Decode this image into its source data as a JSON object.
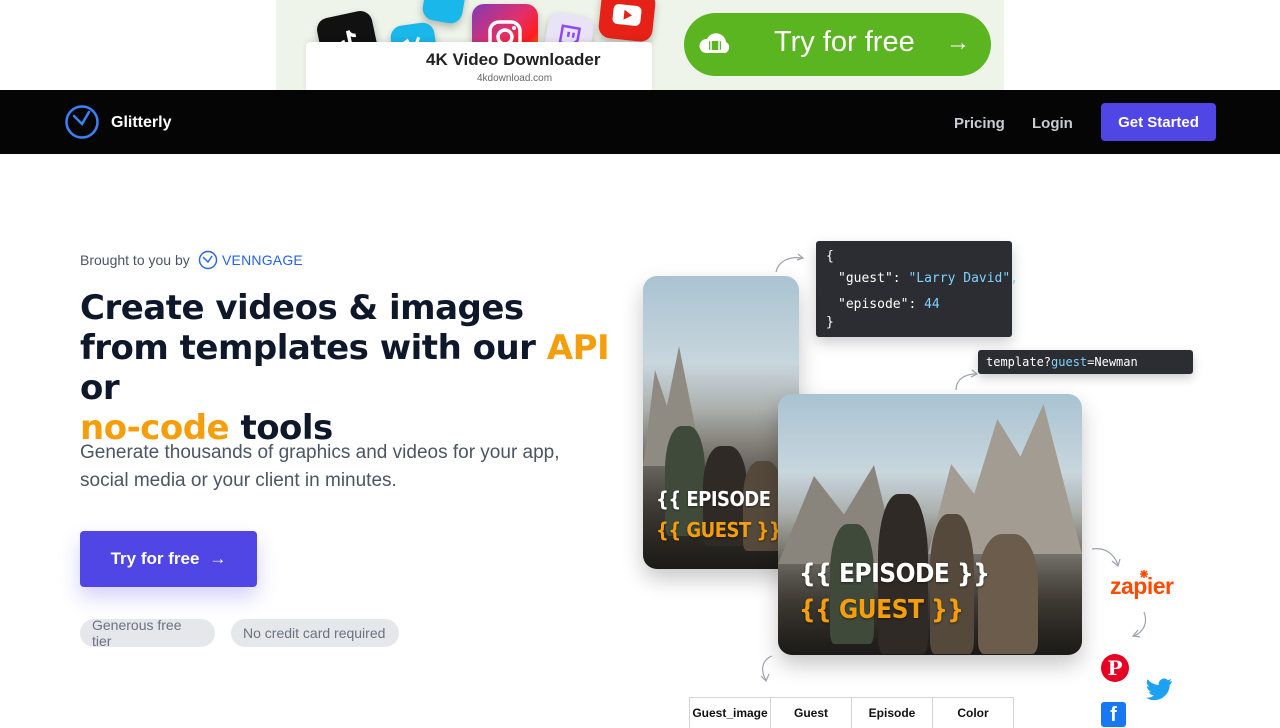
{
  "ad": {
    "title": "4K Video Downloader",
    "domain": "4kdownload.com",
    "cta_label": "Try for free",
    "cta_arrow": "→",
    "colors": {
      "cta": "#5bb521",
      "background": "#eef4ea"
    },
    "icons": [
      "tiktok-icon",
      "vimeo-icon",
      "instagram-icon",
      "twitch-icon",
      "youtube-icon"
    ]
  },
  "nav": {
    "brand": "Glitterly",
    "links": {
      "pricing": "Pricing",
      "login": "Login"
    },
    "cta": "Get Started",
    "colors": {
      "background": "#050505",
      "cta": "#4f46e5"
    }
  },
  "hero": {
    "brought_by": "Brought to you by",
    "partner": "VENNGAGE",
    "headline": {
      "part1": "Create videos & images from templates with our",
      "accent1": "API",
      "part2": "or",
      "accent2": "no-code",
      "part3": "tools"
    },
    "subtext": "Generate thousands of graphics and videos for your app, social media or your client in minutes.",
    "cta_label": "Try for free",
    "cta_arrow": "→",
    "badges": [
      "Generous free tier",
      "No credit card required"
    ],
    "colors": {
      "accent": "#f59e0b",
      "primary": "#4f46e5"
    }
  },
  "illustration": {
    "code": {
      "open": "{",
      "guest_key": "\"guest\":",
      "guest_val": "\"Larry David\",",
      "episode_key": "\"episode\":",
      "episode_val": "44",
      "close": "}"
    },
    "url": {
      "prefix": "template?",
      "param": "guest",
      "value": "=Newman"
    },
    "template_card_small": {
      "episode": "{{ EPISODE }}",
      "guest": "{{ GUEST }}"
    },
    "template_card_large": {
      "episode": "{{ EPISODE }}",
      "guest": "{{ GUEST }}"
    },
    "integrations": {
      "zapier": "zapier",
      "pinterest": "P",
      "facebook": "f"
    },
    "table_headers": [
      "Guest_image",
      "Guest",
      "Episode",
      "Color"
    ]
  }
}
